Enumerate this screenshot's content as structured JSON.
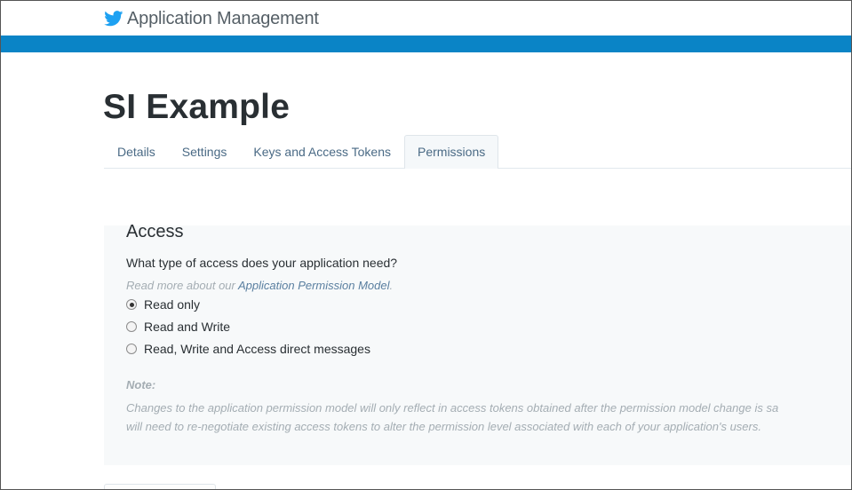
{
  "header": {
    "brand_label": "Application Management",
    "brand_icon": "twitter-bird-icon",
    "brand_color": "#1da1f2",
    "bar_color": "#0a84c6"
  },
  "app": {
    "title": "SI Example"
  },
  "tabs": [
    {
      "label": "Details",
      "active": false
    },
    {
      "label": "Settings",
      "active": false
    },
    {
      "label": "Keys and Access Tokens",
      "active": false
    },
    {
      "label": "Permissions",
      "active": true
    }
  ],
  "access": {
    "title": "Access",
    "question": "What type of access does your application need?",
    "readmore_prefix": "Read more about our ",
    "readmore_link": "Application Permission Model",
    "readmore_suffix": ".",
    "options": [
      {
        "label": "Read only",
        "checked": true
      },
      {
        "label": "Read and Write",
        "checked": false
      },
      {
        "label": "Read, Write and Access direct messages",
        "checked": false
      }
    ],
    "note_label": "Note:",
    "note_line1": "Changes to the application permission model will only reflect in access tokens obtained after the permission model change is sa",
    "note_line2": "will need to re-negotiate existing access tokens to alter the permission level associated with each of your application's users."
  }
}
